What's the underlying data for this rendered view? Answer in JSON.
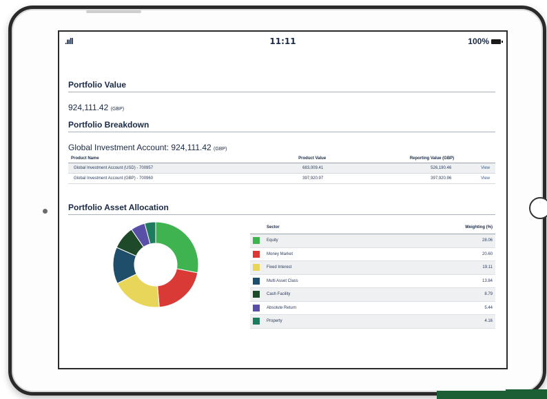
{
  "status": {
    "signal": ".ııll",
    "time": "11:11",
    "battery": "100%"
  },
  "portfolio_value": {
    "title": "Portfolio Value",
    "amount": "924,111.42",
    "currency": "(GBP)"
  },
  "breakdown": {
    "title": "Portfolio Breakdown",
    "account_label": "Global Investment Account: 924,111.42",
    "currency": "(GBP)",
    "headers": [
      "Product Name",
      "Product Value",
      "Reporting Value (GBP)",
      ""
    ],
    "rows": [
      {
        "name": "Global Investment Account (USD) - 700957",
        "product_value": "683,009.41",
        "reporting_value": "526,190.46",
        "action": "View"
      },
      {
        "name": "Global Investment Account (GBP) - 700960",
        "product_value": "397,920.97",
        "reporting_value": "397,920.96",
        "action": "View"
      }
    ]
  },
  "allocation": {
    "title": "Portfolio Asset Allocation",
    "headers": {
      "sector": "Sector",
      "weighting": "Weighting (%)"
    },
    "sectors": [
      {
        "name": "Equity",
        "weight": "28.06",
        "color": "#3fb34f"
      },
      {
        "name": "Money Market",
        "weight": "20.60",
        "color": "#d93a35"
      },
      {
        "name": "Fixed Interest",
        "weight": "19.11",
        "color": "#e8d65a"
      },
      {
        "name": "Multi Asset Class",
        "weight": "13.84",
        "color": "#1f4e6b"
      },
      {
        "name": "Cash Facility",
        "weight": "8.79",
        "color": "#1f4a2a"
      },
      {
        "name": "Absolute Return",
        "weight": "5.44",
        "color": "#5a4fa6"
      },
      {
        "name": "Property",
        "weight": "4.16",
        "color": "#1e7b5e"
      }
    ]
  }
}
